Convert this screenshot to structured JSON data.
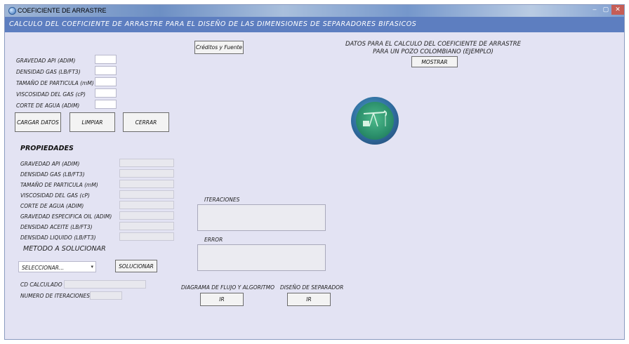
{
  "window": {
    "title": "COEFICIENTE DE ARRASTRE",
    "banner": "CALCULO DEL COEFICIENTE DE ARRASTRE PARA EL DISEÑO DE LAS DIMENSIONES DE SEPARADORES BIFASICOS",
    "controls": {
      "minimize": "–",
      "maximize": "▢",
      "close": "✕"
    }
  },
  "inputs": {
    "labels": [
      "GRAVEDAD API (ADIM)",
      "DENSIDAD GAS (LB/FT3)",
      "TAMAÑO DE PARTICULA (mM)",
      "VISCOSIDAD DEL GAS (cP)",
      "CORTE DE AGUA (ADIM)"
    ]
  },
  "buttons": {
    "creditos": "Créditos y Fuente",
    "cargar": "CARGAR DATOS",
    "limpiar": "LIMPIAR",
    "cerrar": "CERRAR",
    "mostrar": "MOSTRAR",
    "solucionar": "SOLUCIONAR",
    "ir_diagrama": "IR",
    "ir_diseno": "IR"
  },
  "datos_ejemplo": {
    "line1": "DATOS PARA EL CALCULO DEL COEFICIENTE DE ARRASTRE",
    "line2": "PARA UN POZO COLOMBIANO (EJEMPLO)"
  },
  "propiedades": {
    "heading": "PROPIEDADES",
    "labels": [
      "GRAVEDAD API (ADIM)",
      "DENSIDAD GAS (LB/FT3)",
      "TAMAÑO DE PARTICULA (mM)",
      "VISCOSIDAD DEL GAS (cP)",
      "CORTE DE AGUA (ADIM)",
      "GRAVEDAD ESPECIFICA OIL (ADIM)",
      "DENSIDAD ACEITE (LB/FT3)",
      "DENSIDAD LIQUIDO (LB/FT3)"
    ]
  },
  "metodo": {
    "heading": "METODO A SOLUCIONAR",
    "selected": "SELECCIONAR..."
  },
  "results": {
    "cd_label": "CD CALCULADO",
    "iter_label": "NUMERO DE ITERACIONES"
  },
  "panels": {
    "iteraciones": "ITERACIONES",
    "error": "ERROR"
  },
  "links": {
    "diagrama": "DIAGRAMA DE FLUJO Y ALGORITMO",
    "diseno": "DISEÑO DE SEPARADOR"
  },
  "logo": {
    "icon": "pumpjack-logo"
  },
  "colors": {
    "banner": "#5d7ec0",
    "window_bg": "#e3e3f3"
  }
}
